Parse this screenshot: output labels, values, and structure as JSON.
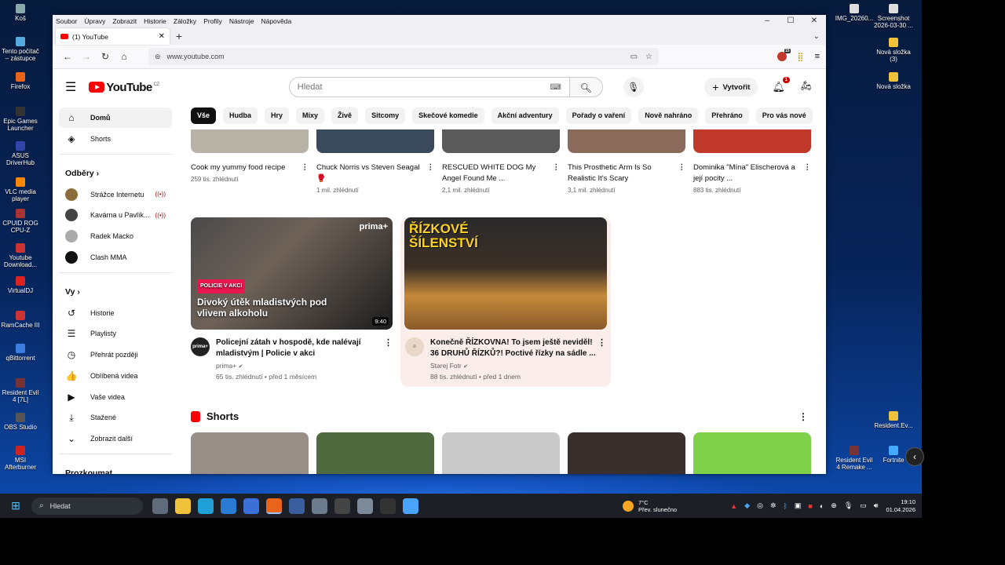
{
  "desktop": {
    "left_icons": [
      "Koš",
      "Tento počítač – zástupce",
      "Firefox",
      "Epic Games Launcher",
      "ASUS DriverHub",
      "VLC media player",
      "CPUID ROG CPU-Z",
      "Youtube Download...",
      "VirtualDJ",
      "RamCache III",
      "qBittorrent",
      "Resident Evil 4 [7L]",
      "OBS Studio",
      "MSI Afterburner"
    ],
    "right_icons": [
      "IMG_20260...",
      "Screenshot 2026-03-30 ...",
      "Nová složka (3)",
      "Nová složka",
      "Resident.Ev...",
      "Resident Evil 4 Remake ...",
      "Fortnite"
    ]
  },
  "browser": {
    "menu": [
      "Soubor",
      "Úpravy",
      "Zobrazit",
      "Historie",
      "Záložky",
      "Profily",
      "Nástroje",
      "Nápověda"
    ],
    "tab_title": "(1) YouTube",
    "url": "www.youtube.com",
    "ext_badge": "15"
  },
  "yt": {
    "country": "CZ",
    "search_placeholder": "Hledat",
    "create_label": "Vytvořit",
    "notif_count": "1",
    "sidebar": {
      "main": [
        {
          "label": "Domů"
        },
        {
          "label": "Shorts"
        }
      ],
      "subs_head": "Odběry",
      "subs": [
        {
          "label": "Strážce Internetu",
          "live": true,
          "color": "#8a6d3b"
        },
        {
          "label": "Kavárna u Pavlík...",
          "live": true,
          "color": "#444"
        },
        {
          "label": "Radek Macko",
          "live": false,
          "color": "#aaa"
        },
        {
          "label": "Clash MMA",
          "live": false,
          "color": "#111"
        }
      ],
      "you_head": "Vy",
      "you": [
        {
          "label": "Historie",
          "icon": "↺"
        },
        {
          "label": "Playlisty",
          "icon": "☰"
        },
        {
          "label": "Přehrát později",
          "icon": "◷"
        },
        {
          "label": "Oblíbená videa",
          "icon": "👍"
        },
        {
          "label": "Vaše videa",
          "icon": "▶"
        },
        {
          "label": "Stažené",
          "icon": "⤓"
        },
        {
          "label": "Zobrazit další",
          "icon": "⌄"
        }
      ],
      "explore_head": "Prozkoumat"
    },
    "chips": [
      "Vše",
      "Hudba",
      "Hry",
      "Mixy",
      "Živě",
      "Sitcomy",
      "Skečové komedie",
      "Akční adventury",
      "Pořady o vaření",
      "Nově nahráno",
      "Přehráno",
      "Pro vás nové"
    ],
    "row1": [
      {
        "title": "Cook my yummy food recipe",
        "meta": "259 tis. zhlédnutí",
        "color": "#b9b2a6"
      },
      {
        "title": "Chuck Norris vs Steven Seagal 🥊",
        "meta": "1 mil. zhlédnutí",
        "color": "#3a4a5c"
      },
      {
        "title": "RESCUED WHITE DOG My Angel Found Me ...",
        "meta": "2,1 mil. zhlédnutí",
        "color": "#5a5a5a"
      },
      {
        "title": "This Prosthetic Arm Is So Realistic It's Scary",
        "meta": "3,1 mil. zhlédnutí",
        "color": "#8a6a5a"
      },
      {
        "title": "Dominika \"Mína\" Elischerová a její pocity ...",
        "meta": "883 tis. zhlédnutí",
        "color": "#c0392b"
      }
    ],
    "video1": {
      "tag": "POLICIE V AKCI",
      "overlay": "Divoký útěk mladistvých pod vlivem alkoholu",
      "brand": "prima+",
      "duration": "9:40",
      "title": "Policejní zátah v hospodě, kde nalévají mladistvým | Policie v akci",
      "channel": "prima+",
      "meta": "65 tis. zhlédnutí • před 1 měsícem"
    },
    "video2": {
      "overlay": "ŘÍZKOVÉ ŠÍLENSTVÍ",
      "title": "Konečně ŘÍZKOVNA! To jsem ještě neviděl! 36 DRUHŮ ŘÍZKŮ?! Poctivé řízky na sádle ...",
      "channel": "Starej Fotr",
      "meta": "88 tis. zhlédnutí • před 1 dnem"
    },
    "shorts_head": "Shorts",
    "shorts_colors": [
      "#9a8f86",
      "#4f6a3e",
      "#c9c9c9",
      "#3a2f2a",
      "#7fd14a"
    ]
  },
  "taskbar": {
    "search": "Hledat",
    "temp": "7°C",
    "weather": "Přev. slunečno",
    "time": "19:10",
    "date": "01.04.2026"
  }
}
